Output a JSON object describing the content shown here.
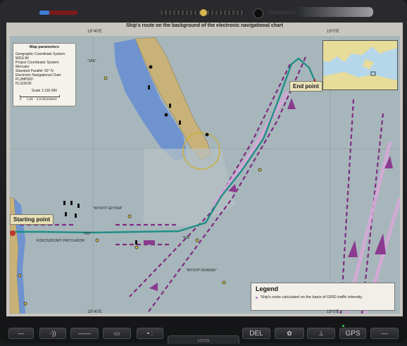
{
  "device": {
    "bottom_buttons": [
      {
        "name": "minus-button",
        "label": "—"
      },
      {
        "name": "sound-button",
        "label": "·))"
      },
      {
        "name": "line-button",
        "label": "——"
      },
      {
        "name": "window-button",
        "label": "▭"
      },
      {
        "name": "dots-button",
        "label": "• :"
      },
      {
        "name": "delete-button",
        "label": "DEL"
      },
      {
        "name": "settings-button",
        "label": "✿"
      },
      {
        "name": "anchor-button",
        "label": "⊥"
      },
      {
        "name": "gps-button",
        "label": "GPS"
      },
      {
        "name": "minus-right-button",
        "label": "—"
      }
    ],
    "brand_text": "LOTUS"
  },
  "map": {
    "title": "Ship's route on the background of the electronic navigational chart",
    "lon_left": "18°40'E",
    "lon_right": "19°0'E",
    "params": {
      "title": "Map parameters",
      "lines": [
        "Geographic Coordinate System: WGS 84",
        "Project Coordinator System: Mercator",
        "Standard Parallel: 55° N",
        "Electronic Navigational Chart",
        "PL2MP500",
        "PL3J3030"
      ],
      "scale": "Scale 1:130 000",
      "scalebar_labels": [
        "0",
        "1,25",
        "2,5 Kilometers"
      ]
    },
    "place_labels": {
      "jas": "\"JAS\"",
      "wysyp_gdynia": "\"WYSYP GDYNIA\"",
      "gn": "\"GN\"",
      "go": "\"GO\"",
      "wysyp_gdansk": "\"WYSYP GDANSK\"",
      "kokoszkowy": "KOKOSZKOWY PRZYLADOR"
    },
    "callouts": {
      "start": "Starting point",
      "end": "End point"
    },
    "legend": {
      "title": "Legend",
      "item": "Ship's route calculated on the basis of GRID traffic intensity"
    }
  },
  "colors": {
    "route": "#1f8f86",
    "lanes": "#8b3a8f",
    "land": "#c8b27a",
    "water": "#a7b6bb",
    "shallow": "#6f93cf"
  }
}
